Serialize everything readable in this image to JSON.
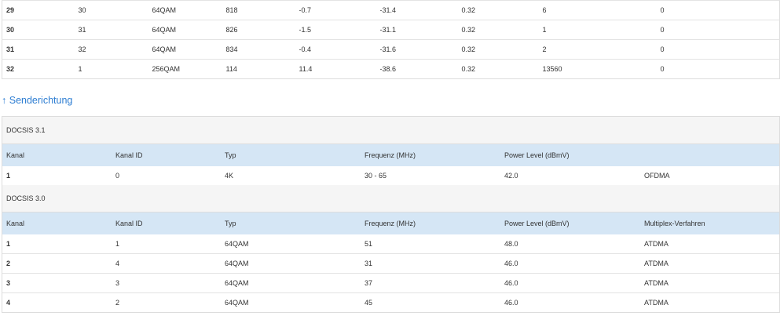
{
  "downstream_rows": [
    [
      "29",
      "30",
      "64QAM",
      "818",
      "-0.7",
      "-31.4",
      "0.32",
      "6",
      "0"
    ],
    [
      "30",
      "31",
      "64QAM",
      "826",
      "-1.5",
      "-31.1",
      "0.32",
      "1",
      "0"
    ],
    [
      "31",
      "32",
      "64QAM",
      "834",
      "-0.4",
      "-31.6",
      "0.32",
      "2",
      "0"
    ],
    [
      "32",
      "1",
      "256QAM",
      "114",
      "11.4",
      "-38.6",
      "0.32",
      "13560",
      "0"
    ]
  ],
  "section_link": {
    "arrow": "↑",
    "label": "Senderichtung"
  },
  "upstream": {
    "docsis31": {
      "title": "DOCSIS 3.1",
      "headers": [
        "Kanal",
        "Kanal ID",
        "Typ",
        "Frequenz (MHz)",
        "Power Level (dBmV)",
        ""
      ],
      "rows": [
        [
          "1",
          "0",
          "4K",
          "30 - 65",
          "42.0",
          "OFDMA"
        ]
      ]
    },
    "docsis30": {
      "title": "DOCSIS 3.0",
      "headers": [
        "Kanal",
        "Kanal ID",
        "Typ",
        "Frequenz (MHz)",
        "Power Level (dBmV)",
        "Multiplex-Verfahren"
      ],
      "rows": [
        [
          "1",
          "1",
          "64QAM",
          "51",
          "48.0",
          "ATDMA"
        ],
        [
          "2",
          "4",
          "64QAM",
          "31",
          "46.0",
          "ATDMA"
        ],
        [
          "3",
          "3",
          "64QAM",
          "37",
          "46.0",
          "ATDMA"
        ],
        [
          "4",
          "2",
          "64QAM",
          "45",
          "46.0",
          "ATDMA"
        ]
      ]
    }
  },
  "colors": {
    "link": "#2d7dd2",
    "header_bg": "#d5e6f5",
    "group_bg": "#f5f5f5"
  }
}
